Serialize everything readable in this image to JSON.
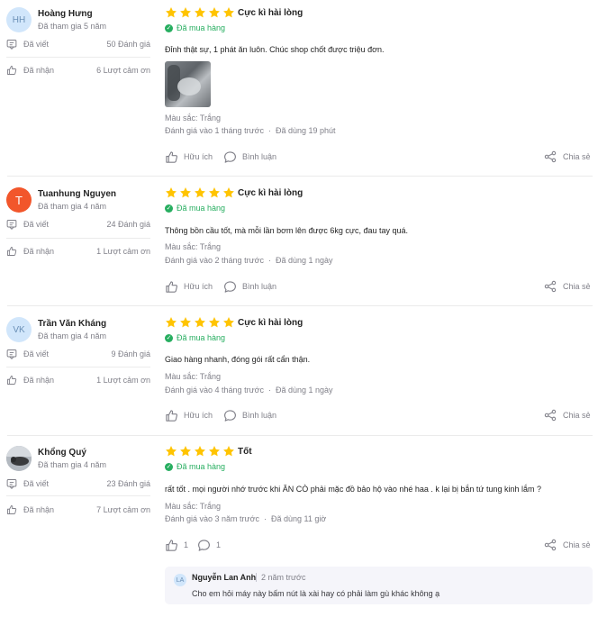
{
  "reviews": [
    {
      "avatar_text": "HH",
      "name": "Hoàng Hưng",
      "joined": "Đã tham gia 5 năm",
      "written_label": "Đã viết",
      "written_value": "50 Đánh giá",
      "received_label": "Đã nhận",
      "received_value": "6 Lượt cảm ơn",
      "rating": 5,
      "title": "Cực kì hài lòng",
      "bought": "Đã mua hàng",
      "content": "Đỉnh thật sự, 1 phát ăn luôn. Chúc shop chốt được triệu đơn.",
      "color": "Màu sắc: Trắng",
      "reviewed": "Đánh giá vào 1 tháng trước",
      "used": "Đã dùng 19 phút",
      "helpful": "Hữu ích",
      "comment": "Bình luận",
      "share": "Chia sẻ"
    },
    {
      "avatar_text": "T",
      "name": "Tuanhung Nguyen",
      "joined": "Đã tham gia 4 năm",
      "written_label": "Đã viết",
      "written_value": "24 Đánh giá",
      "received_label": "Đã nhận",
      "received_value": "1 Lượt cảm ơn",
      "rating": 5,
      "title": "Cực kì hài lòng",
      "bought": "Đã mua hàng",
      "content": "Thông bồn cầu tốt, mà mỗi lần bơm lên được 6kg cực, đau tay quá.",
      "color": "Màu sắc: Trắng",
      "reviewed": "Đánh giá vào 2 tháng trước",
      "used": "Đã dùng 1 ngày",
      "helpful": "Hữu ích",
      "comment": "Bình luận",
      "share": "Chia sẻ"
    },
    {
      "avatar_text": "VK",
      "name": "Trần Văn Kháng",
      "joined": "Đã tham gia 4 năm",
      "written_label": "Đã viết",
      "written_value": "9 Đánh giá",
      "received_label": "Đã nhận",
      "received_value": "1 Lượt cảm ơn",
      "rating": 5,
      "title": "Cực kì hài lòng",
      "bought": "Đã mua hàng",
      "content": "Giao hàng nhanh, đóng gói rất cẩn thận.",
      "color": "Màu sắc: Trắng",
      "reviewed": "Đánh giá vào 4 tháng trước",
      "used": "Đã dùng 1 ngày",
      "helpful": "Hữu ích",
      "comment": "Bình luận",
      "share": "Chia sẻ"
    },
    {
      "avatar_text": "",
      "name": "Khổng Quý",
      "joined": "Đã tham gia 4 năm",
      "written_label": "Đã viết",
      "written_value": "23 Đánh giá",
      "received_label": "Đã nhận",
      "received_value": "7 Lượt cảm ơn",
      "rating": 5,
      "title": "Tốt",
      "bought": "Đã mua hàng",
      "content": "rất tốt . mọi người nhớ trước khi ĂN CÒ phải mặc đồ bảo hộ vào nhé haa . k lại bị bắn tứ tung kinh lắm ?",
      "color": "Màu sắc: Trắng",
      "reviewed": "Đánh giá vào 3 năm trước",
      "used": "Đã dùng 11 giờ",
      "helpful_count": "1",
      "comment_count": "1",
      "share": "Chia sẻ",
      "reply": {
        "avatar_text": "LA",
        "name": "Nguyễn Lan Anh",
        "time": "2 năm trước",
        "text": "Cho em hỏi máy này bấm nút là xài hay có phải làm gù khác không ạ"
      }
    }
  ],
  "colors": {
    "star": "#ffc400",
    "bought": "#27ae60",
    "muted": "#808089",
    "avatar_bg": "#d1e6fb",
    "avatar_orange": "#f2562b"
  }
}
